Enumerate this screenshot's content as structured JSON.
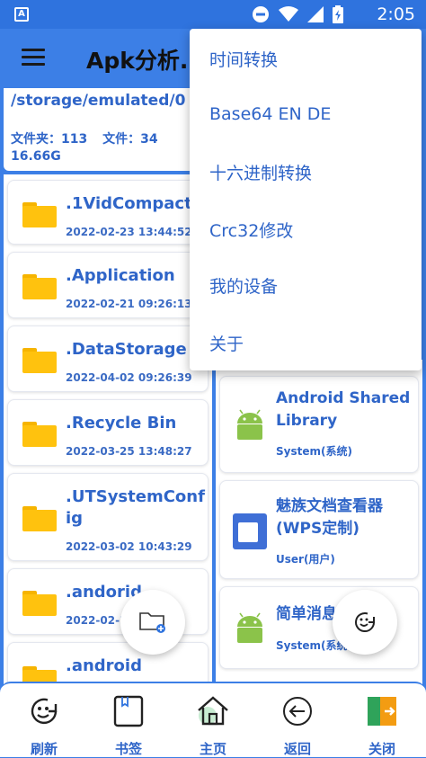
{
  "status": {
    "time": "2:05",
    "app_icon": "A"
  },
  "appbar": {
    "title": "Apk分析..."
  },
  "path": {
    "current": "/storage/emulated/0",
    "folder_count": "文件夹：113",
    "file_count": "文件：34",
    "total_size": "16.66G"
  },
  "files": [
    {
      "name": ".1VidCompact",
      "date": "2022-02-23 13:44:52"
    },
    {
      "name": ".Application",
      "date": "2022-02-21 09:26:13"
    },
    {
      "name": ".DataStorage",
      "date": "2022-04-02 09:26:39"
    },
    {
      "name": ".Recycle Bin",
      "date": "2022-03-25 13:48:27"
    },
    {
      "name": ".UTSystemConfig",
      "date": "2022-03-02 10:43:29"
    },
    {
      "name": ".andorid",
      "date": "2022-02-1"
    },
    {
      "name": ".android",
      "date": ""
    }
  ],
  "apps": [
    {
      "name": "Android Shared Library",
      "type": "System(系统)"
    },
    {
      "name": "魅族文档查看器(WPS定制)",
      "type": "User(用户)"
    },
    {
      "name": "简单消息",
      "type": "System(系统"
    }
  ],
  "menu": {
    "items": [
      "时间转换",
      "Base64 EN DE",
      "十六进制转换",
      "Crc32修改",
      "我的设备",
      "关于"
    ]
  },
  "nav": {
    "refresh": "刷新",
    "bookmark": "书签",
    "home": "主页",
    "back": "返回",
    "close": "关闭"
  },
  "colors": {
    "primary": "#3c7fe6",
    "text_blue": "#2f65c8",
    "folder_yellow": "#ffc20e",
    "android_green": "#8bc34a"
  }
}
